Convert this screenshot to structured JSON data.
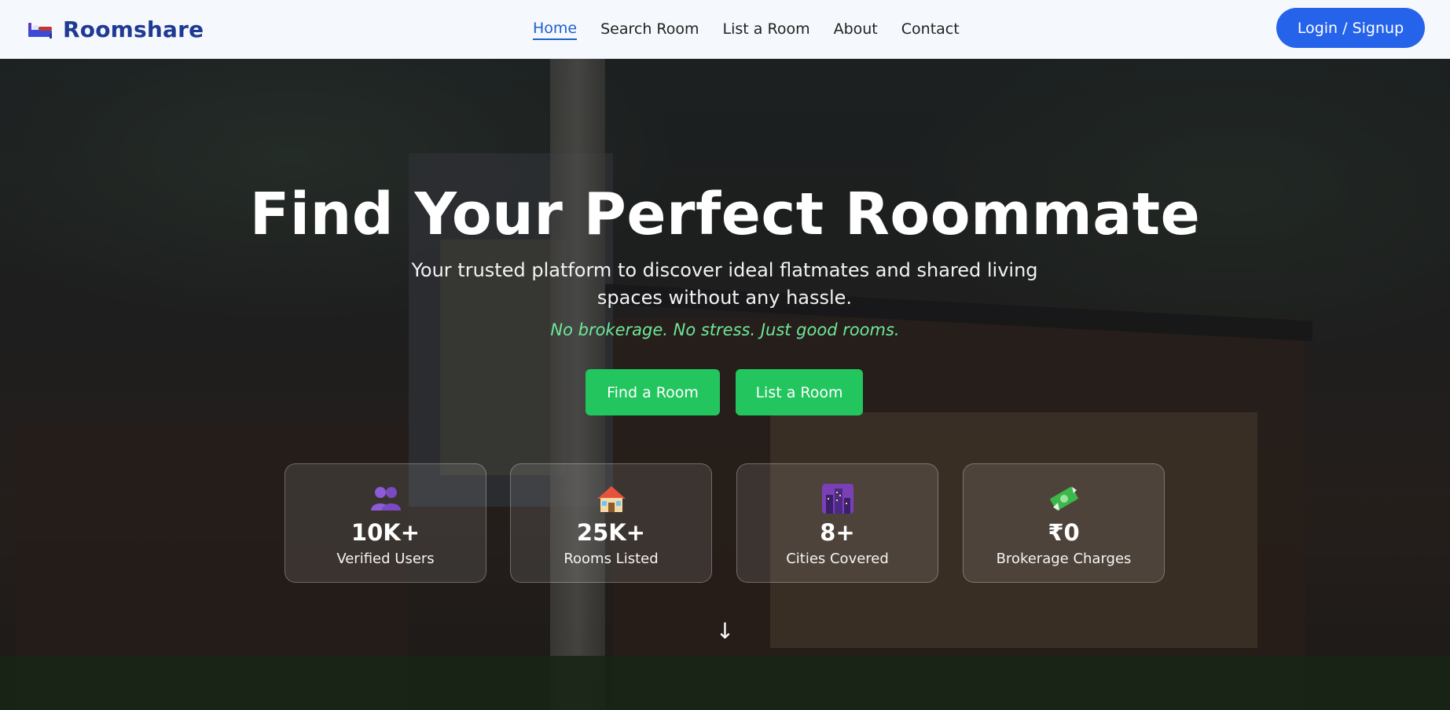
{
  "header": {
    "brand": "Roomshare",
    "nav": [
      {
        "label": "Home",
        "active": true
      },
      {
        "label": "Search Room",
        "active": false
      },
      {
        "label": "List a Room",
        "active": false
      },
      {
        "label": "About",
        "active": false
      },
      {
        "label": "Contact",
        "active": false
      }
    ],
    "login_label": "Login / Signup"
  },
  "hero": {
    "title": "Find Your Perfect Roommate",
    "subtitle": "Your trusted platform to discover ideal flatmates and shared living spaces without any hassle.",
    "tagline": "No brokerage. No stress. Just good rooms.",
    "cta_find": "Find a Room",
    "cta_list": "List a Room",
    "scroll_glyph": "↓"
  },
  "stats": [
    {
      "icon": "users-icon",
      "value": "10K+",
      "label": "Verified Users"
    },
    {
      "icon": "house-icon",
      "value": "25K+",
      "label": "Rooms Listed"
    },
    {
      "icon": "city-icon",
      "value": "8+",
      "label": "Cities Covered"
    },
    {
      "icon": "money-icon",
      "value": "₹0",
      "label": "Brokerage Charges"
    }
  ],
  "colors": {
    "brand": "#1f3a93",
    "login_button": "#2563eb",
    "cta_button": "#22c55e",
    "tagline": "#6ee79a",
    "nav_active": "#1f5fcf"
  }
}
